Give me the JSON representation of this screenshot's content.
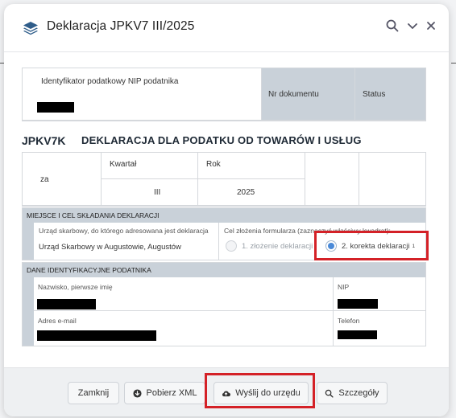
{
  "window": {
    "title": "Deklaracja JPKV7 III/2025",
    "icons": [
      "stack-icon",
      "search-icon",
      "chevron-down-icon",
      "close-icon"
    ]
  },
  "form": {
    "nip_label": "Identyfikator podatkowy NIP podatnika",
    "nr_dokumentu_label": "Nr dokumentu",
    "status_label": "Status",
    "code": "JPKV7K",
    "declaration_title": "DEKLARACJA DLA PODATKU OD TOWARÓW I USŁUG",
    "za_label": "za",
    "kwartal_label": "Kwartał",
    "kwartal_value": "III",
    "rok_label": "Rok",
    "rok_value": "2025",
    "section1_title": "MIEJSCE I CEL SKŁADANIA DEKLARACJI",
    "urzad_label": "Urząd skarbowy, do którego adresowana jest deklaracja",
    "urzad_value": "Urząd Skarbowy w Augustowie, Augustów",
    "cel_label": "Cel złożenia formularza (zaznaczyć właściwy kwadrat):",
    "option1": "1. złożenie deklaracji",
    "option2": "2. korekta deklaracji",
    "option2_sup": "1",
    "selected_option": 2,
    "section2_title": "DANE IDENTYFIKACYJNE PODATNIKA",
    "nazwisko_label": "Nazwisko, pierwsze imię",
    "nip2_label": "NIP",
    "email_label": "Adres e-mail",
    "telefon_label": "Telefon"
  },
  "footer": {
    "zamknij": "Zamknij",
    "pobierz": "Pobierz XML",
    "wyslij": "Wyślij do urzędu",
    "szczegoly": "Szczegóły"
  },
  "colors": {
    "highlight": "#d42127",
    "section_bg": "#c9d1d9",
    "radio_selected": "#4a8ad8"
  }
}
